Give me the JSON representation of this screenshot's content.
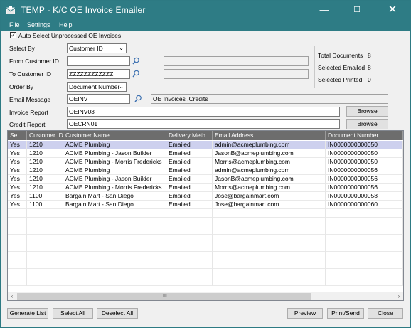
{
  "window": {
    "title": "TEMP - K/C OE Invoice Emailer",
    "min": "—",
    "max": "☐",
    "close": "✕"
  },
  "menu": [
    "File",
    "Settings",
    "Help"
  ],
  "auto_select": {
    "label": "Auto Select Unprocessed OE Invoices",
    "checked": true,
    "mark": "✓"
  },
  "select_by": {
    "label": "Select By",
    "value": "Customer ID"
  },
  "from_customer": {
    "label": "From Customer ID",
    "value": "",
    "desc": ""
  },
  "to_customer": {
    "label": "To Customer ID",
    "value": "ZZZZZZZZZZZZ",
    "desc": ""
  },
  "order_by": {
    "label": "Order By",
    "value": "Document Number"
  },
  "email_message": {
    "label": "Email Message",
    "value": "OEINV",
    "desc": "OE Invoices ,Credits"
  },
  "invoice_report": {
    "label": "Invoice Report",
    "value": "OEINV03",
    "browse": "Browse"
  },
  "credit_report": {
    "label": "Credit Report",
    "value": "OECRN01",
    "browse": "Browse"
  },
  "stats": {
    "total_label": "Total Documents",
    "total_value": "8",
    "emailed_label": "Selected Emailed",
    "emailed_value": "8",
    "printed_label": "Selected Printed",
    "printed_value": "0"
  },
  "grid": {
    "columns": [
      "Se...",
      "Customer ID",
      "Customer Name",
      "Delivery Meth...",
      "Email Address",
      "Document Number"
    ],
    "rows": [
      [
        "Yes",
        "1210",
        "ACME Plumbing",
        "Emailed",
        "admin@acmeplumbing.com",
        "IN0000000000050"
      ],
      [
        "Yes",
        "1210",
        "ACME Plumbing - Jason Builder",
        "Emailed",
        "JasonB@acmeplumbing.com",
        "IN0000000000050"
      ],
      [
        "Yes",
        "1210",
        "ACME Plumbing - Morris Fredericks",
        "Emailed",
        "Morris@acmeplumbing.com",
        "IN0000000000050"
      ],
      [
        "Yes",
        "1210",
        "ACME Plumbing",
        "Emailed",
        "admin@acmeplumbing.com",
        "IN0000000000056"
      ],
      [
        "Yes",
        "1210",
        "ACME Plumbing - Jason Builder",
        "Emailed",
        "JasonB@acmeplumbing.com",
        "IN0000000000056"
      ],
      [
        "Yes",
        "1210",
        "ACME Plumbing - Morris Fredericks",
        "Emailed",
        "Morris@acmeplumbing.com",
        "IN0000000000056"
      ],
      [
        "Yes",
        "1100",
        "Bargain Mart - San Diego",
        "Emailed",
        "Jose@bargainmart.com",
        "IN0000000000058"
      ],
      [
        "Yes",
        "1100",
        "Bargain Mart - San Diego",
        "Emailed",
        "Jose@bargainmart.com",
        "IN0000000000060"
      ]
    ],
    "scroll_left": "‹",
    "scroll_right": "›",
    "scroll_grip": "III"
  },
  "buttons": {
    "generate": "Generate List",
    "select_all": "Select All",
    "deselect_all": "Deselect All",
    "preview": "Preview",
    "print_send": "Print/Send",
    "close": "Close"
  },
  "colors": {
    "titlebar": "#2e7c85",
    "selected_row": "#cdd0ee",
    "header": "#6d6d6d"
  }
}
